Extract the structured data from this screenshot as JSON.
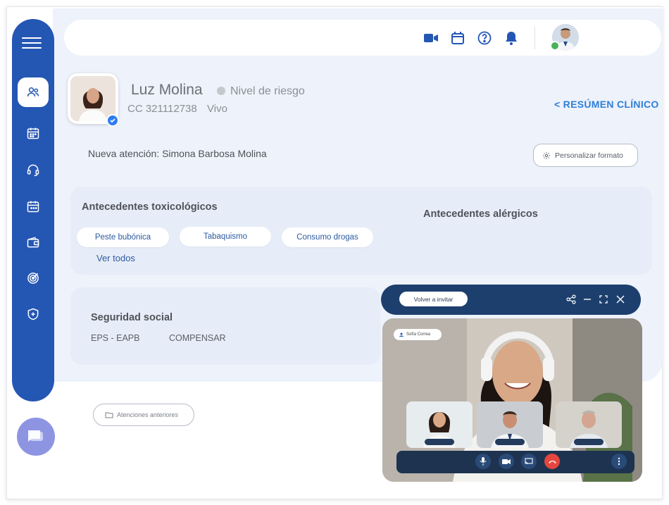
{
  "patient": {
    "name": "Luz Molina",
    "risk_label": "Nivel de riesgo",
    "id": "CC 321112738",
    "status": "Vivo"
  },
  "clinical_summary_link": "< RESÚMEN CLÍNICO",
  "attention": {
    "title": "Nueva atención: Simona Barbosa Molina",
    "customize_button": "Personalizar formato"
  },
  "toxicological": {
    "title": "Antecedentes toxicológicos",
    "chips": [
      "Peste bubónica",
      "Tabaquismo",
      "Consumo drogas"
    ],
    "see_all": "Ver todos"
  },
  "allergic": {
    "title": "Antecedentes alérgicos"
  },
  "social_security": {
    "title": "Seguridad social",
    "eps_label": "EPS - EAPB",
    "eps_value": "COMPENSAR"
  },
  "previous_attentions_button": "Atenciones anteriores",
  "videocall": {
    "reinvite_button": "Volver a invitar",
    "participant_name": "Sofía Correa"
  },
  "colors": {
    "sidebar": "#2456b4",
    "accent": "#2e7ed7",
    "background": "#edf2fb",
    "videocall_bar": "#1d3f6e",
    "hangup": "#e5463f"
  },
  "icons": {
    "sidebar": [
      "menu-icon",
      "patients-icon",
      "calendar-icon",
      "headset-icon",
      "agenda-icon",
      "wallet-icon",
      "target-icon",
      "shield-icon"
    ],
    "topbar": [
      "video-icon",
      "calendar-icon",
      "help-icon",
      "bell-icon"
    ]
  }
}
